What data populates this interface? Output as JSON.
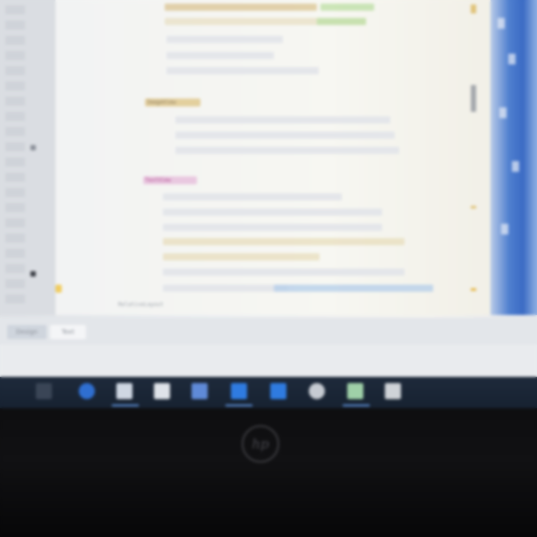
{
  "editor": {
    "xml_tags": [
      {
        "name": "ImageView"
      },
      {
        "name": "TextView"
      }
    ],
    "breadcrumb": "RelativeLayout"
  },
  "tool_tabs": [
    "Design",
    "Text"
  ],
  "taskbar": {
    "apps": [
      "task-view",
      "edge",
      "file-explorer",
      "store",
      "word",
      "app-blue-1",
      "app-blue-2",
      "chrome",
      "android-studio",
      "toolbox"
    ]
  },
  "laptop": {
    "brand_logo": "hp"
  }
}
